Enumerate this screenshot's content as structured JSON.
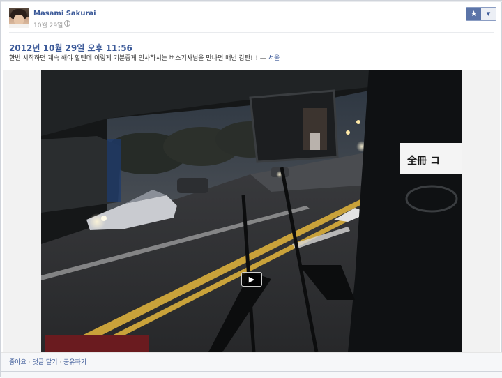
{
  "author": {
    "name": "Masami Sakurai",
    "date": "10월 29일"
  },
  "post": {
    "title": "2012년 10월 29일 오후 11:56",
    "text": "한번 시작하면 계속 해야 할텐데 이렇게 기분좋게 인사하시는 버스기사님을 만나면 매번 감탄!!!",
    "location_prefix": " — ",
    "location": "서울"
  },
  "video": {
    "play_icon": "▶",
    "sign_text": "全冊 コ"
  },
  "footer": {
    "like": "좋아요",
    "comment": "댓글 달기",
    "share": "공유하기",
    "separator": " · "
  },
  "icons": {
    "star": "★",
    "chevron": "▾",
    "globe": "globe-icon"
  },
  "colors": {
    "link": "#3b5998",
    "star_bg": "#5b74a8"
  }
}
